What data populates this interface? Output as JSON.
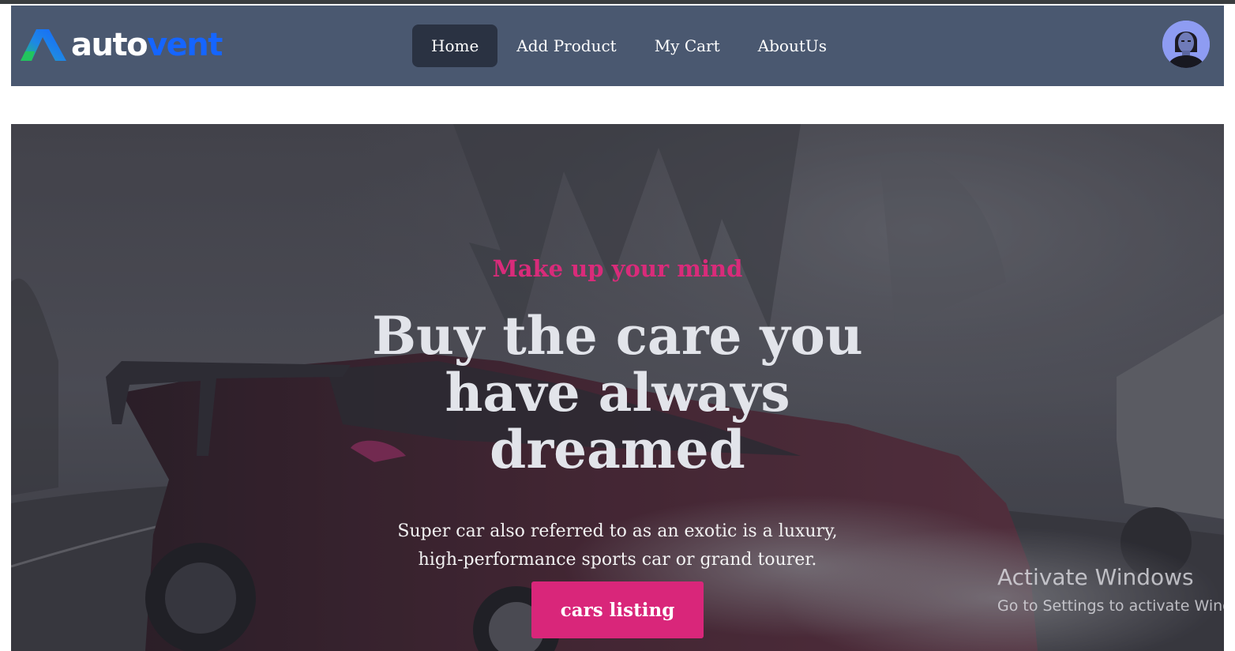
{
  "brand": {
    "name_part1": "auto",
    "name_part2": "vent",
    "colors": {
      "primary": "#ffffff",
      "accent": "#1565ff",
      "logo_mark_gradient": [
        "#1e88e5",
        "#22c55e"
      ]
    }
  },
  "nav": {
    "items": [
      {
        "label": "Home",
        "active": true
      },
      {
        "label": "Add Product",
        "active": false
      },
      {
        "label": "My Cart",
        "active": false
      },
      {
        "label": "AboutUs",
        "active": false
      }
    ],
    "background": "#4a5870",
    "active_background": "#2a3242"
  },
  "user": {
    "avatar_icon": "user-avatar"
  },
  "hero": {
    "tagline": "Make up your mind",
    "headline": "Buy the care you have always dreamed",
    "description": "Super car also referred to as an exotic is a luxury, high-performance sports car or grand tourer.",
    "cta_label": "cars listing",
    "accent_color": "#d9267a"
  },
  "watermark": {
    "title": "Activate Windows",
    "subtitle": "Go to Settings to activate Windows."
  }
}
